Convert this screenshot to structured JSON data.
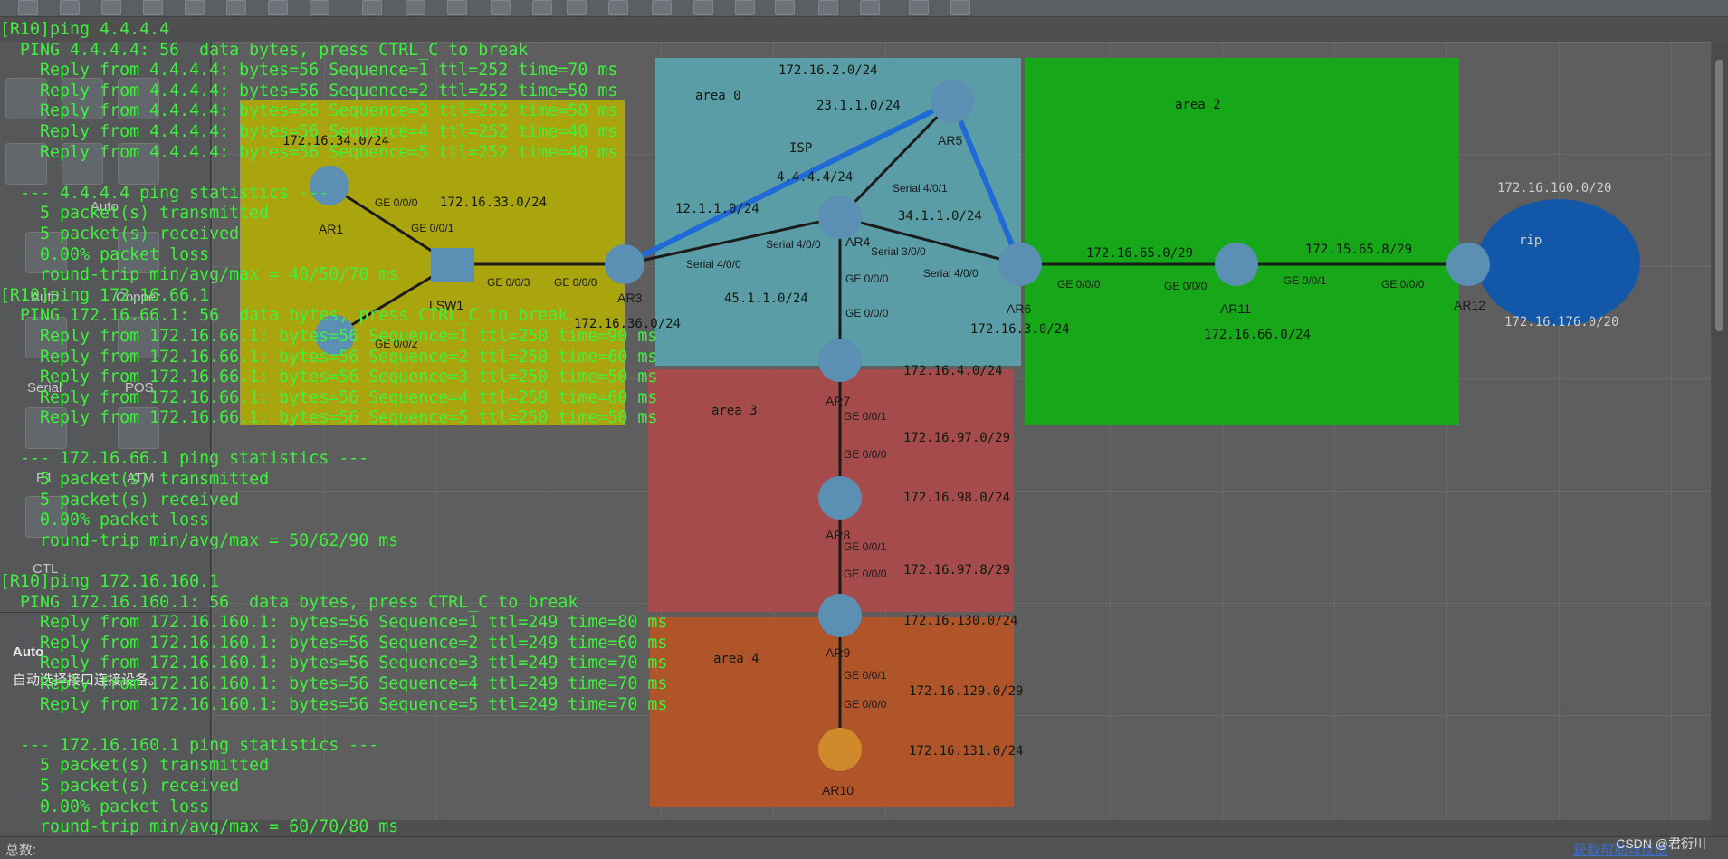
{
  "toolbar": {
    "icons": [
      "new-topo-icon",
      "new-device-icon",
      "open-icon",
      "save-icon",
      "save-as-icon",
      "print-icon",
      "undo-icon",
      "redo-icon",
      "select-icon",
      "hand-icon",
      "delete-icon",
      "delete-link-icon",
      "text-icon",
      "rect-icon",
      "zoom-in-icon",
      "zoom-out-icon",
      "fit-icon",
      "start-icon",
      "stop-icon",
      "capture-icon",
      "console-icon",
      "settings-icon",
      "help-icon"
    ]
  },
  "palette": {
    "cable_items": [
      {
        "label": "Auto"
      },
      {
        "label": "Copper"
      },
      {
        "label": "Serial"
      },
      {
        "label": "POS"
      },
      {
        "label": "E1"
      },
      {
        "label": "ATM"
      },
      {
        "label": "CTL"
      }
    ],
    "tab_label": "Auto",
    "description_title": "Auto",
    "description_text": "自动选择接口连接设备。"
  },
  "topology": {
    "areas": [
      {
        "name": "area 0",
        "color": "#5aa8b4"
      },
      {
        "name": "area 2",
        "color": "#17a81a"
      },
      {
        "name": "area 3",
        "color": "#a54b4b"
      },
      {
        "name": "area 4",
        "color": "#b0542a"
      },
      {
        "name": "rip",
        "color": "#1358a8"
      }
    ],
    "isp_label": "ISP",
    "devices": [
      "AR1",
      "AR3",
      "AR4",
      "AR5",
      "AR6",
      "AR7",
      "AR8",
      "AR9",
      "AR10",
      "AR11",
      "AR12",
      "LSW1"
    ],
    "networks": [
      "172.16.2.0/24",
      "23.1.1.0/24",
      "4.4.4.4/24",
      "12.1.1.0/24",
      "34.1.1.0/24",
      "45.1.1.0/24",
      "172.16.34.0/24",
      "172.16.33.0/24",
      "172.16.36.0/24",
      "172.16.65.0/29",
      "172.16.66.0/24",
      "172.15.65.8/29",
      "172.16.160.0/20",
      "172.16.176.0/20",
      "172.16.3.0/24",
      "172.16.4.0/24",
      "172.16.97.0/29",
      "172.16.98.0/24",
      "172.16.97.8/29",
      "172.16.130.0/24",
      "172.16.129.0/29",
      "172.16.131.0/24"
    ],
    "ports": [
      "GE 0/0/0",
      "GE 0/0/1",
      "GE 0/0/3",
      "GE 0/0/0",
      "GE 0/0/2",
      "Serial 4/0/0",
      "Serial 4/0/0",
      "Serial 4/0/1",
      "Serial 3/0/0",
      "Serial 4/0/0",
      "GE 0/0/0",
      "GE 0/0/0",
      "GE 0/0/0",
      "GE 0/0/1",
      "GE 0/0/0",
      "GE 0/0/0",
      "GE 0/0/1",
      "GE 0/0/0",
      "GE 0/0/1",
      "GE 0/0/0",
      "GE 0/0/1",
      "GE 0/0/0"
    ]
  },
  "terminal": {
    "lines": [
      "[R10]ping 4.4.4.4",
      "  PING 4.4.4.4: 56  data bytes, press CTRL_C to break",
      "    Reply from 4.4.4.4: bytes=56 Sequence=1 ttl=252 time=70 ms",
      "    Reply from 4.4.4.4: bytes=56 Sequence=2 ttl=252 time=50 ms",
      "    Reply from 4.4.4.4: bytes=56 Sequence=3 ttl=252 time=50 ms",
      "    Reply from 4.4.4.4: bytes=56 Sequence=4 ttl=252 time=40 ms",
      "    Reply from 4.4.4.4: bytes=56 Sequence=5 ttl=252 time=40 ms",
      "",
      "  --- 4.4.4.4 ping statistics ---",
      "    5 packet(s) transmitted",
      "    5 packet(s) received",
      "    0.00% packet loss",
      "    round-trip min/avg/max = 40/50/70 ms",
      "[R10]ping 172.16.66.1",
      "  PING 172.16.66.1: 56  data bytes, press CTRL_C to break",
      "    Reply from 172.16.66.1: bytes=56 Sequence=1 ttl=250 time=90 ms",
      "    Reply from 172.16.66.1: bytes=56 Sequence=2 ttl=250 time=60 ms",
      "    Reply from 172.16.66.1: bytes=56 Sequence=3 ttl=250 time=50 ms",
      "    Reply from 172.16.66.1: bytes=56 Sequence=4 ttl=250 time=60 ms",
      "    Reply from 172.16.66.1: bytes=56 Sequence=5 ttl=250 time=50 ms",
      "",
      "  --- 172.16.66.1 ping statistics ---",
      "    5 packet(s) transmitted",
      "    5 packet(s) received",
      "    0.00% packet loss",
      "    round-trip min/avg/max = 50/62/90 ms",
      "",
      "[R10]ping 172.16.160.1",
      "  PING 172.16.160.1: 56  data bytes, press CTRL_C to break",
      "    Reply from 172.16.160.1: bytes=56 Sequence=1 ttl=249 time=80 ms",
      "    Reply from 172.16.160.1: bytes=56 Sequence=2 ttl=249 time=60 ms",
      "    Reply from 172.16.160.1: bytes=56 Sequence=3 ttl=249 time=70 ms",
      "    Reply from 172.16.160.1: bytes=56 Sequence=4 ttl=249 time=70 ms",
      "    Reply from 172.16.160.1: bytes=56 Sequence=5 ttl=249 time=70 ms",
      "",
      "  --- 172.16.160.1 ping statistics ---",
      "    5 packet(s) transmitted",
      "    5 packet(s) received",
      "    0.00% packet loss",
      "    round-trip min/avg/max = 60/70/80 ms"
    ]
  },
  "statusbar": {
    "left": "总数:",
    "link": "获取帮助与反馈"
  },
  "watermark": "CSDN @君衍川"
}
